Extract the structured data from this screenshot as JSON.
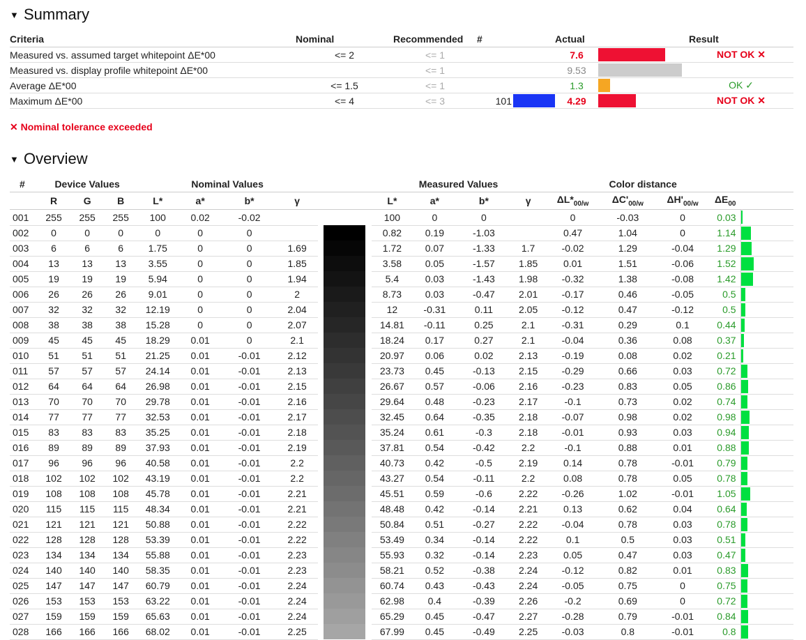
{
  "summary": {
    "title": "Summary",
    "headers": {
      "criteria": "Criteria",
      "nominal": "Nominal",
      "recommended": "Recommended",
      "num": "#",
      "actual": "Actual",
      "result": "Result"
    },
    "rows": [
      {
        "criteria": "Measured vs. assumed target whitepoint ΔE*00",
        "nominal": "<= 2",
        "recommended": "<= 1",
        "num": "",
        "actual": "7.6",
        "status": "fail",
        "result": "NOT OK ✕",
        "bar_fraction": 0.8,
        "bar_color": "#ee1133"
      },
      {
        "criteria": "Measured vs. display profile whitepoint ΔE*00",
        "nominal": "",
        "recommended": "<= 1",
        "num": "",
        "actual": "9.53",
        "status": "neutral",
        "result": "",
        "bar_fraction": 1.0,
        "bar_color": "#cccccc"
      },
      {
        "criteria": "Average ΔE*00",
        "nominal": "<= 1.5",
        "recommended": "<= 1",
        "num": "",
        "actual": "1.3",
        "status": "pass",
        "result": "OK ✓",
        "bar_fraction": 0.14,
        "bar_color": "#f5a623"
      },
      {
        "criteria": "Maximum ΔE*00",
        "nominal": "<= 4",
        "recommended": "<= 3",
        "num": "101",
        "actual": "4.29",
        "status": "fail",
        "result": "NOT OK ✕",
        "bar_fraction": 0.45,
        "bar_color": "#ee1133",
        "swatch_color": "#1a35f5"
      }
    ],
    "note": "✕ Nominal tolerance exceeded"
  },
  "overview": {
    "title": "Overview",
    "group_headers": {
      "num": "#",
      "device": "Device Values",
      "nominal": "Nominal Values",
      "measured": "Measured Values",
      "distance": "Color distance"
    },
    "col_headers": {
      "R": "R",
      "G": "G",
      "B": "B",
      "L": "L*",
      "a": "a*",
      "b": "b*",
      "gamma": "γ",
      "mL": "L*",
      "ma": "a*",
      "mb": "b*",
      "mgamma": "γ",
      "dL": "ΔL*",
      "dL_sub": "00/w",
      "dC": "ΔC'",
      "dC_sub": "00/w",
      "dH": "ΔH'",
      "dH_sub": "00/w",
      "dE": "ΔE",
      "dE_sub": "00"
    },
    "rows": [
      {
        "n": "001",
        "R": 255,
        "G": 255,
        "B": 255,
        "L": "100",
        "a": "0.02",
        "b": "-0.02",
        "g": "",
        "mL": "100",
        "ma": "0",
        "mb": "0",
        "mg": "",
        "dL": "0",
        "dC": "-0.03",
        "dH": "0",
        "dE": "0.03",
        "sw": "#ffffff"
      },
      {
        "n": "002",
        "R": 0,
        "G": 0,
        "B": 0,
        "L": "0",
        "a": "0",
        "b": "0",
        "g": "",
        "mL": "0.82",
        "ma": "0.19",
        "mb": "-1.03",
        "mg": "",
        "dL": "0.47",
        "dC": "1.04",
        "dH": "0",
        "dE": "1.14",
        "sw": "#000000"
      },
      {
        "n": "003",
        "R": 6,
        "G": 6,
        "B": 6,
        "L": "1.75",
        "a": "0",
        "b": "0",
        "g": "1.69",
        "mL": "1.72",
        "ma": "0.07",
        "mb": "-1.33",
        "mg": "1.7",
        "dL": "-0.02",
        "dC": "1.29",
        "dH": "-0.04",
        "dE": "1.29",
        "sw": "#060606"
      },
      {
        "n": "004",
        "R": 13,
        "G": 13,
        "B": 13,
        "L": "3.55",
        "a": "0",
        "b": "0",
        "g": "1.85",
        "mL": "3.58",
        "ma": "0.05",
        "mb": "-1.57",
        "mg": "1.85",
        "dL": "0.01",
        "dC": "1.51",
        "dH": "-0.06",
        "dE": "1.52",
        "sw": "#0d0d0d"
      },
      {
        "n": "005",
        "R": 19,
        "G": 19,
        "B": 19,
        "L": "5.94",
        "a": "0",
        "b": "0",
        "g": "1.94",
        "mL": "5.4",
        "ma": "0.03",
        "mb": "-1.43",
        "mg": "1.98",
        "dL": "-0.32",
        "dC": "1.38",
        "dH": "-0.08",
        "dE": "1.42",
        "sw": "#131313"
      },
      {
        "n": "006",
        "R": 26,
        "G": 26,
        "B": 26,
        "L": "9.01",
        "a": "0",
        "b": "0",
        "g": "2",
        "mL": "8.73",
        "ma": "0.03",
        "mb": "-0.47",
        "mg": "2.01",
        "dL": "-0.17",
        "dC": "0.46",
        "dH": "-0.05",
        "dE": "0.5",
        "sw": "#1a1a1a"
      },
      {
        "n": "007",
        "R": 32,
        "G": 32,
        "B": 32,
        "L": "12.19",
        "a": "0",
        "b": "0",
        "g": "2.04",
        "mL": "12",
        "ma": "-0.31",
        "mb": "0.11",
        "mg": "2.05",
        "dL": "-0.12",
        "dC": "0.47",
        "dH": "-0.12",
        "dE": "0.5",
        "sw": "#202020"
      },
      {
        "n": "008",
        "R": 38,
        "G": 38,
        "B": 38,
        "L": "15.28",
        "a": "0",
        "b": "0",
        "g": "2.07",
        "mL": "14.81",
        "ma": "-0.11",
        "mb": "0.25",
        "mg": "2.1",
        "dL": "-0.31",
        "dC": "0.29",
        "dH": "0.1",
        "dE": "0.44",
        "sw": "#262626"
      },
      {
        "n": "009",
        "R": 45,
        "G": 45,
        "B": 45,
        "L": "18.29",
        "a": "0.01",
        "b": "0",
        "g": "2.1",
        "mL": "18.24",
        "ma": "0.17",
        "mb": "0.27",
        "mg": "2.1",
        "dL": "-0.04",
        "dC": "0.36",
        "dH": "0.08",
        "dE": "0.37",
        "sw": "#2d2d2d"
      },
      {
        "n": "010",
        "R": 51,
        "G": 51,
        "B": 51,
        "L": "21.25",
        "a": "0.01",
        "b": "-0.01",
        "g": "2.12",
        "mL": "20.97",
        "ma": "0.06",
        "mb": "0.02",
        "mg": "2.13",
        "dL": "-0.19",
        "dC": "0.08",
        "dH": "0.02",
        "dE": "0.21",
        "sw": "#333333"
      },
      {
        "n": "011",
        "R": 57,
        "G": 57,
        "B": 57,
        "L": "24.14",
        "a": "0.01",
        "b": "-0.01",
        "g": "2.13",
        "mL": "23.73",
        "ma": "0.45",
        "mb": "-0.13",
        "mg": "2.15",
        "dL": "-0.29",
        "dC": "0.66",
        "dH": "0.03",
        "dE": "0.72",
        "sw": "#393939"
      },
      {
        "n": "012",
        "R": 64,
        "G": 64,
        "B": 64,
        "L": "26.98",
        "a": "0.01",
        "b": "-0.01",
        "g": "2.15",
        "mL": "26.67",
        "ma": "0.57",
        "mb": "-0.06",
        "mg": "2.16",
        "dL": "-0.23",
        "dC": "0.83",
        "dH": "0.05",
        "dE": "0.86",
        "sw": "#404040"
      },
      {
        "n": "013",
        "R": 70,
        "G": 70,
        "B": 70,
        "L": "29.78",
        "a": "0.01",
        "b": "-0.01",
        "g": "2.16",
        "mL": "29.64",
        "ma": "0.48",
        "mb": "-0.23",
        "mg": "2.17",
        "dL": "-0.1",
        "dC": "0.73",
        "dH": "0.02",
        "dE": "0.74",
        "sw": "#464646"
      },
      {
        "n": "014",
        "R": 77,
        "G": 77,
        "B": 77,
        "L": "32.53",
        "a": "0.01",
        "b": "-0.01",
        "g": "2.17",
        "mL": "32.45",
        "ma": "0.64",
        "mb": "-0.35",
        "mg": "2.18",
        "dL": "-0.07",
        "dC": "0.98",
        "dH": "0.02",
        "dE": "0.98",
        "sw": "#4d4d4d"
      },
      {
        "n": "015",
        "R": 83,
        "G": 83,
        "B": 83,
        "L": "35.25",
        "a": "0.01",
        "b": "-0.01",
        "g": "2.18",
        "mL": "35.24",
        "ma": "0.61",
        "mb": "-0.3",
        "mg": "2.18",
        "dL": "-0.01",
        "dC": "0.93",
        "dH": "0.03",
        "dE": "0.94",
        "sw": "#535353"
      },
      {
        "n": "016",
        "R": 89,
        "G": 89,
        "B": 89,
        "L": "37.93",
        "a": "0.01",
        "b": "-0.01",
        "g": "2.19",
        "mL": "37.81",
        "ma": "0.54",
        "mb": "-0.42",
        "mg": "2.2",
        "dL": "-0.1",
        "dC": "0.88",
        "dH": "0.01",
        "dE": "0.88",
        "sw": "#595959"
      },
      {
        "n": "017",
        "R": 96,
        "G": 96,
        "B": 96,
        "L": "40.58",
        "a": "0.01",
        "b": "-0.01",
        "g": "2.2",
        "mL": "40.73",
        "ma": "0.42",
        "mb": "-0.5",
        "mg": "2.19",
        "dL": "0.14",
        "dC": "0.78",
        "dH": "-0.01",
        "dE": "0.79",
        "sw": "#606060"
      },
      {
        "n": "018",
        "R": 102,
        "G": 102,
        "B": 102,
        "L": "43.19",
        "a": "0.01",
        "b": "-0.01",
        "g": "2.2",
        "mL": "43.27",
        "ma": "0.54",
        "mb": "-0.11",
        "mg": "2.2",
        "dL": "0.08",
        "dC": "0.78",
        "dH": "0.05",
        "dE": "0.78",
        "sw": "#666666"
      },
      {
        "n": "019",
        "R": 108,
        "G": 108,
        "B": 108,
        "L": "45.78",
        "a": "0.01",
        "b": "-0.01",
        "g": "2.21",
        "mL": "45.51",
        "ma": "0.59",
        "mb": "-0.6",
        "mg": "2.22",
        "dL": "-0.26",
        "dC": "1.02",
        "dH": "-0.01",
        "dE": "1.05",
        "sw": "#6c6c6c"
      },
      {
        "n": "020",
        "R": 115,
        "G": 115,
        "B": 115,
        "L": "48.34",
        "a": "0.01",
        "b": "-0.01",
        "g": "2.21",
        "mL": "48.48",
        "ma": "0.42",
        "mb": "-0.14",
        "mg": "2.21",
        "dL": "0.13",
        "dC": "0.62",
        "dH": "0.04",
        "dE": "0.64",
        "sw": "#737373"
      },
      {
        "n": "021",
        "R": 121,
        "G": 121,
        "B": 121,
        "L": "50.88",
        "a": "0.01",
        "b": "-0.01",
        "g": "2.22",
        "mL": "50.84",
        "ma": "0.51",
        "mb": "-0.27",
        "mg": "2.22",
        "dL": "-0.04",
        "dC": "0.78",
        "dH": "0.03",
        "dE": "0.78",
        "sw": "#797979"
      },
      {
        "n": "022",
        "R": 128,
        "G": 128,
        "B": 128,
        "L": "53.39",
        "a": "0.01",
        "b": "-0.01",
        "g": "2.22",
        "mL": "53.49",
        "ma": "0.34",
        "mb": "-0.14",
        "mg": "2.22",
        "dL": "0.1",
        "dC": "0.5",
        "dH": "0.03",
        "dE": "0.51",
        "sw": "#808080"
      },
      {
        "n": "023",
        "R": 134,
        "G": 134,
        "B": 134,
        "L": "55.88",
        "a": "0.01",
        "b": "-0.01",
        "g": "2.23",
        "mL": "55.93",
        "ma": "0.32",
        "mb": "-0.14",
        "mg": "2.23",
        "dL": "0.05",
        "dC": "0.47",
        "dH": "0.03",
        "dE": "0.47",
        "sw": "#868686"
      },
      {
        "n": "024",
        "R": 140,
        "G": 140,
        "B": 140,
        "L": "58.35",
        "a": "0.01",
        "b": "-0.01",
        "g": "2.23",
        "mL": "58.21",
        "ma": "0.52",
        "mb": "-0.38",
        "mg": "2.24",
        "dL": "-0.12",
        "dC": "0.82",
        "dH": "0.01",
        "dE": "0.83",
        "sw": "#8c8c8c"
      },
      {
        "n": "025",
        "R": 147,
        "G": 147,
        "B": 147,
        "L": "60.79",
        "a": "0.01",
        "b": "-0.01",
        "g": "2.24",
        "mL": "60.74",
        "ma": "0.43",
        "mb": "-0.43",
        "mg": "2.24",
        "dL": "-0.05",
        "dC": "0.75",
        "dH": "0",
        "dE": "0.75",
        "sw": "#939393"
      },
      {
        "n": "026",
        "R": 153,
        "G": 153,
        "B": 153,
        "L": "63.22",
        "a": "0.01",
        "b": "-0.01",
        "g": "2.24",
        "mL": "62.98",
        "ma": "0.4",
        "mb": "-0.39",
        "mg": "2.26",
        "dL": "-0.2",
        "dC": "0.69",
        "dH": "0",
        "dE": "0.72",
        "sw": "#999999"
      },
      {
        "n": "027",
        "R": 159,
        "G": 159,
        "B": 159,
        "L": "65.63",
        "a": "0.01",
        "b": "-0.01",
        "g": "2.24",
        "mL": "65.29",
        "ma": "0.45",
        "mb": "-0.47",
        "mg": "2.27",
        "dL": "-0.28",
        "dC": "0.79",
        "dH": "-0.01",
        "dE": "0.84",
        "sw": "#9f9f9f"
      },
      {
        "n": "028",
        "R": 166,
        "G": 166,
        "B": 166,
        "L": "68.02",
        "a": "0.01",
        "b": "-0.01",
        "g": "2.25",
        "mL": "67.99",
        "ma": "0.45",
        "mb": "-0.49",
        "mg": "2.25",
        "dL": "-0.03",
        "dC": "0.8",
        "dH": "-0.01",
        "dE": "0.8",
        "sw": "#a6a6a6"
      }
    ]
  }
}
